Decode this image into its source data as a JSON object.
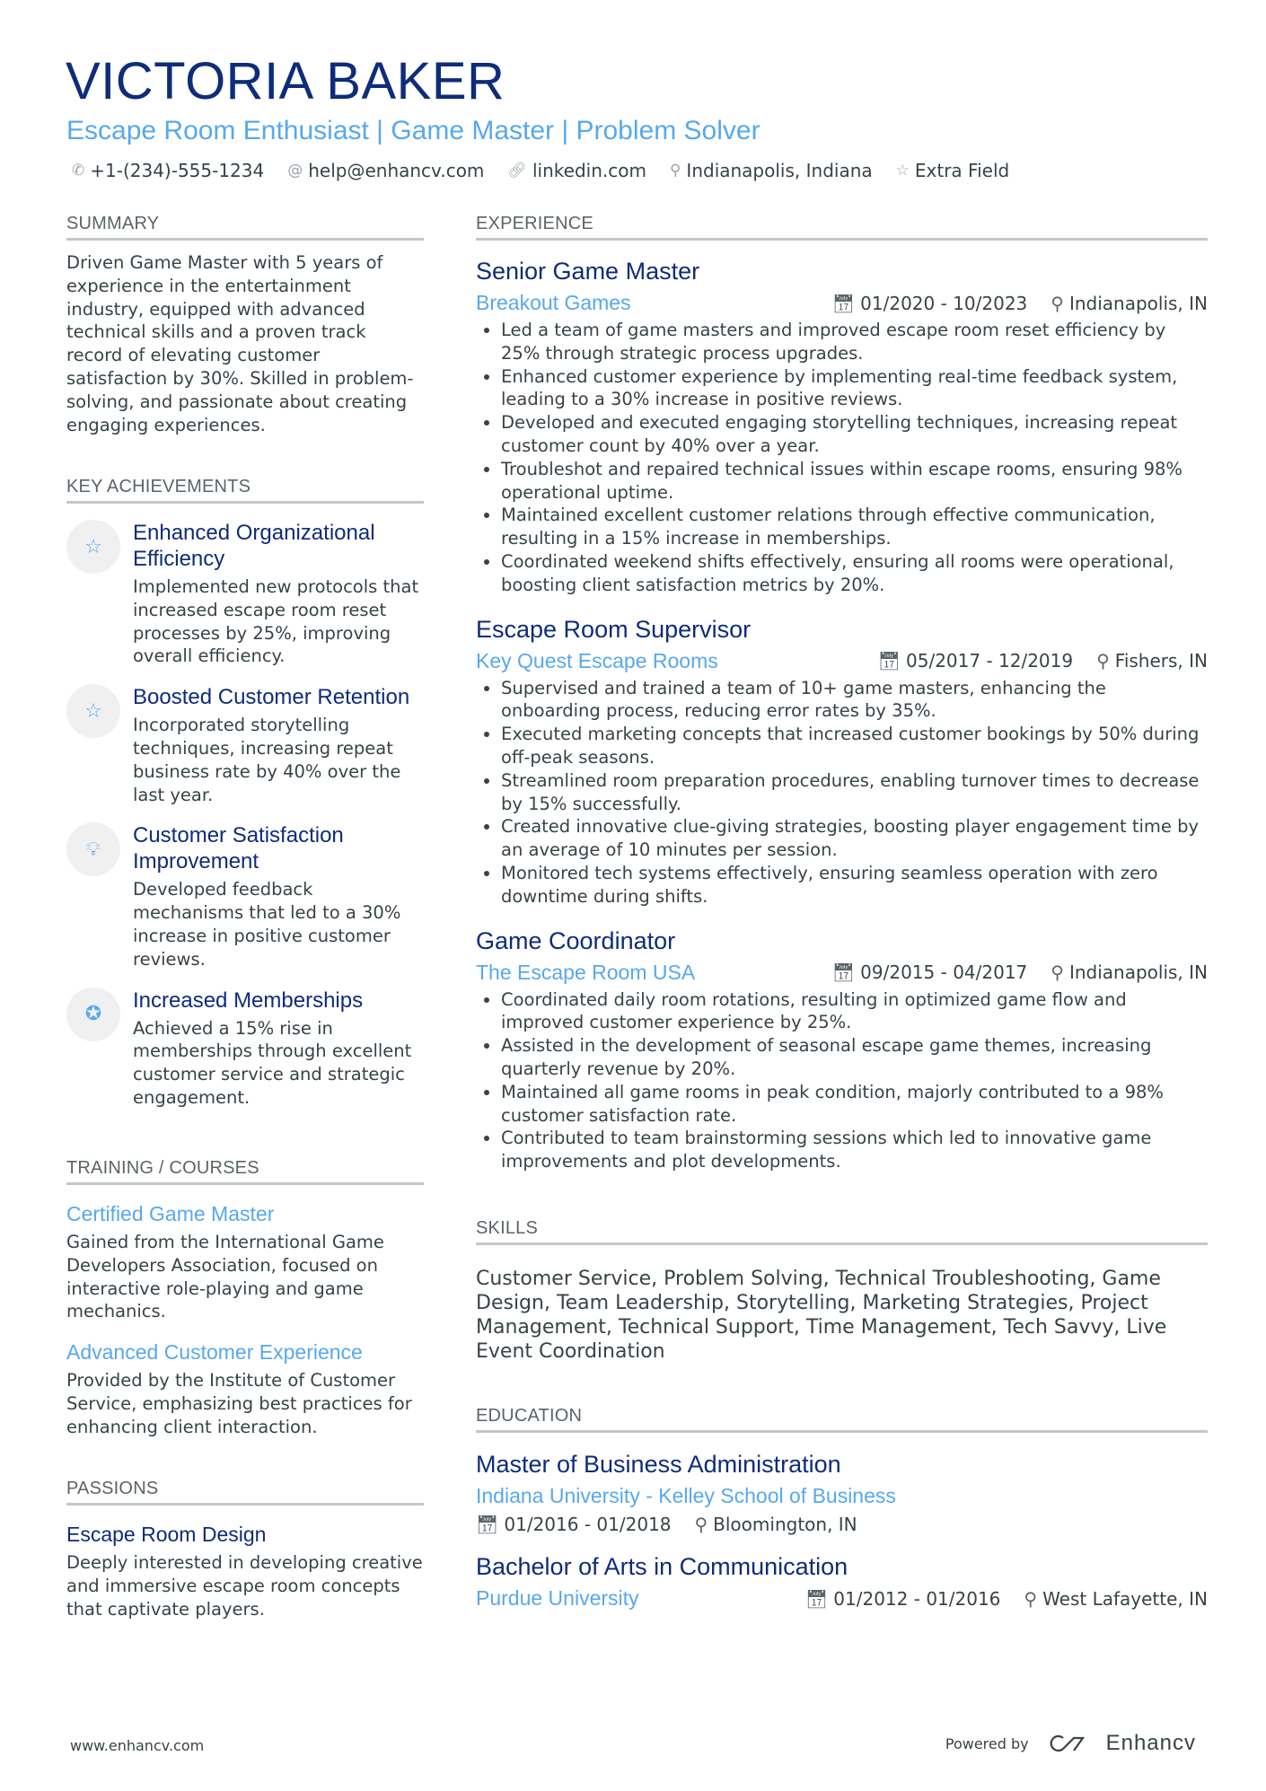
{
  "header": {
    "name": "VICTORIA BAKER",
    "tagline": "Escape Room Enthusiast | Game Master | Problem Solver",
    "contacts": [
      {
        "icon": "phone-icon",
        "text": "+1-(234)-555-1234"
      },
      {
        "icon": "at-icon",
        "text": "help@enhancv.com"
      },
      {
        "icon": "link-icon",
        "text": "linkedin.com"
      },
      {
        "icon": "location-pin-icon",
        "text": "Indianapolis, Indiana"
      },
      {
        "icon": "star-icon",
        "text": "Extra Field"
      }
    ]
  },
  "summary": {
    "heading": "SUMMARY",
    "text": "Driven Game Master with 5 years of experience in the entertainment industry, equipped with advanced technical skills and a proven track record of elevating customer satisfaction by 30%. Skilled in problem-solving, and passionate about creating engaging experiences."
  },
  "achievements": {
    "heading": "KEY ACHIEVEMENTS",
    "items": [
      {
        "icon": "star-half-icon",
        "title": "Enhanced Organizational Efficiency",
        "desc": "Implemented new protocols that increased escape room reset processes by 25%, improving overall efficiency."
      },
      {
        "icon": "star-half-icon",
        "title": "Boosted Customer Retention",
        "desc": "Incorporated storytelling techniques, increasing repeat business rate by 40% over the last year."
      },
      {
        "icon": "lightbulb-icon",
        "title": "Customer Satisfaction Improvement",
        "desc": "Developed feedback mechanisms that led to a 30% increase in positive customer reviews."
      },
      {
        "icon": "award-ribbon-icon",
        "title": "Increased Memberships",
        "desc": "Achieved a 15% rise in memberships through excellent customer service and strategic engagement."
      }
    ]
  },
  "training": {
    "heading": "TRAINING / COURSES",
    "items": [
      {
        "title": "Certified Game Master",
        "desc": "Gained from the International Game Developers Association, focused on interactive role-playing and game mechanics."
      },
      {
        "title": "Advanced Customer Experience",
        "desc": "Provided by the Institute of Customer Service, emphasizing best practices for enhancing client interaction."
      }
    ]
  },
  "passions": {
    "heading": "PASSIONS",
    "items": [
      {
        "title": "Escape Room Design",
        "desc": "Deeply interested in developing creative and immersive escape room concepts that captivate players."
      }
    ]
  },
  "experience": {
    "heading": "EXPERIENCE",
    "jobs": [
      {
        "title": "Senior Game Master",
        "company": "Breakout Games",
        "dates": "01/2020 - 10/2023",
        "location": "Indianapolis, IN",
        "bullets": [
          "Led a team of game masters and improved escape room reset efficiency by 25% through strategic process upgrades.",
          "Enhanced customer experience by implementing real-time feedback system, leading to a 30% increase in positive reviews.",
          "Developed and executed engaging storytelling techniques, increasing repeat customer count by 40% over a year.",
          "Troubleshot and repaired technical issues within escape rooms, ensuring 98% operational uptime.",
          "Maintained excellent customer relations through effective communication, resulting in a 15% increase in memberships.",
          "Coordinated weekend shifts effectively, ensuring all rooms were operational, boosting client satisfaction metrics by 20%."
        ]
      },
      {
        "title": "Escape Room Supervisor",
        "company": "Key Quest Escape Rooms",
        "dates": "05/2017 - 12/2019",
        "location": "Fishers, IN",
        "bullets": [
          "Supervised and trained a team of 10+ game masters, enhancing the onboarding process, reducing error rates by 35%.",
          "Executed marketing concepts that increased customer bookings by 50% during off-peak seasons.",
          "Streamlined room preparation procedures, enabling turnover times to decrease by 15% successfully.",
          "Created innovative clue-giving strategies, boosting player engagement time by an average of 10 minutes per session.",
          "Monitored tech systems effectively, ensuring seamless operation with zero downtime during shifts."
        ]
      },
      {
        "title": "Game Coordinator",
        "company": "The Escape Room USA",
        "dates": "09/2015 - 04/2017",
        "location": "Indianapolis, IN",
        "bullets": [
          "Coordinated daily room rotations, resulting in optimized game flow and improved customer experience by 25%.",
          "Assisted in the development of seasonal escape game themes, increasing quarterly revenue by 20%.",
          "Maintained all game rooms in peak condition, majorly contributed to a 98% customer satisfaction rate.",
          "Contributed to team brainstorming sessions which led to innovative game improvements and plot developments."
        ]
      }
    ]
  },
  "skills": {
    "heading": "SKILLS",
    "text": "Customer Service, Problem Solving, Technical Troubleshooting, Game Design, Team Leadership, Storytelling, Marketing Strategies, Project Management, Technical Support, Time Management, Tech Savvy, Live Event Coordination"
  },
  "education": {
    "heading": "EDUCATION",
    "items": [
      {
        "degree": "Master of Business Administration",
        "school": "Indiana University - Kelley School of Business",
        "dates": "01/2016 - 01/2018",
        "location": "Bloomington, IN"
      },
      {
        "degree": "Bachelor of Arts in Communication",
        "school": "Purdue University",
        "dates": "01/2012 - 01/2016",
        "location": "West Lafayette, IN"
      }
    ]
  },
  "footer": {
    "website": "www.enhancv.com",
    "powered_by": "Powered by",
    "brand": "Enhancv"
  }
}
